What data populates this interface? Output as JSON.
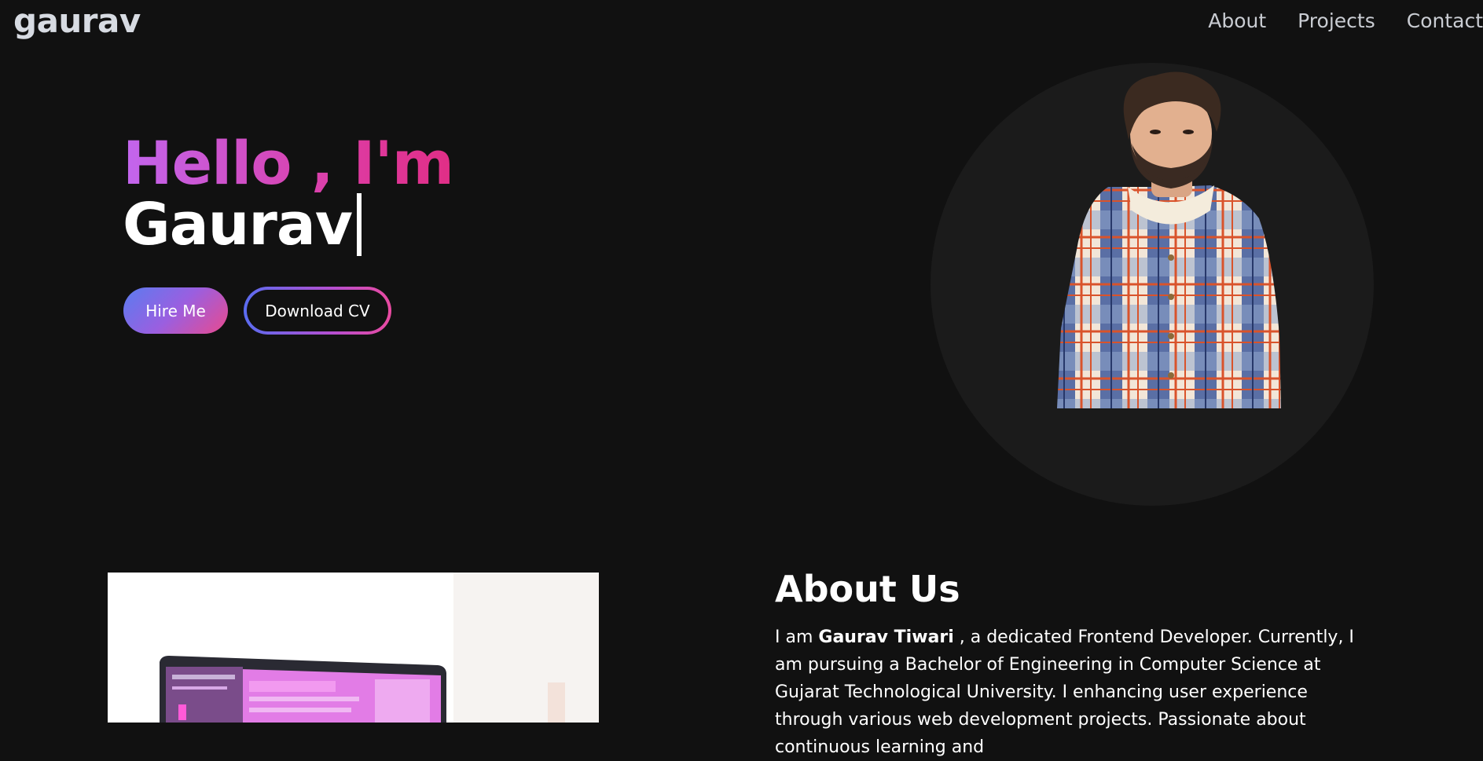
{
  "header": {
    "logo": "gaurav",
    "nav": [
      {
        "label": "About"
      },
      {
        "label": "Projects"
      },
      {
        "label": "Contact"
      }
    ]
  },
  "hero": {
    "greeting": "Hello , I'm",
    "name": "Gaurav",
    "hire_label": "Hire Me",
    "cv_label": "Download CV"
  },
  "about": {
    "title": "About Us",
    "intro": "I am ",
    "name_bold": "Gaurav Tiwari",
    "body": " , a dedicated Frontend Developer. Currently, I am pursuing a Bachelor of Engineering in Computer Science at Gujarat Technological University. I enhancing user experience through various web development projects. Passionate about continuous learning and"
  },
  "colors": {
    "background": "#111111",
    "accent_purple": "#c266ee",
    "accent_pink": "#e02e86",
    "accent_blue": "#5a7cf0"
  }
}
